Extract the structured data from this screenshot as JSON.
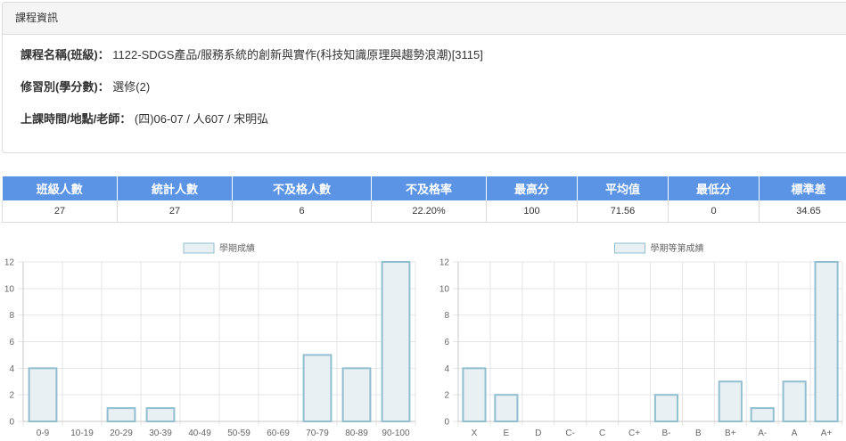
{
  "panel": {
    "title": "課程資訊",
    "course_name_label": "課程名稱(班級)：",
    "course_name_value": "1122-SDGS產品/服務系統的創新與實作(科技知識原理與趨勢浪潮)[3115]",
    "type_label": "修習別(學分數)：",
    "type_value": "選修(2)",
    "time_label": "上課時間/地點/老師：",
    "time_value": "(四)06-07 / 人607 / 宋明弘"
  },
  "stats": {
    "headers": [
      "班級人數",
      "統計人數",
      "不及格人數",
      "不及格率",
      "最高分",
      "平均值",
      "最低分",
      "標準差"
    ],
    "values": [
      "27",
      "27",
      "6",
      "22.20%",
      "100",
      "71.56",
      "0",
      "34.65"
    ]
  },
  "colors": {
    "header_bg": "#5b93e5",
    "bar_fill": "#e8f0f4",
    "bar_stroke": "#92bfcf",
    "grid": "#e5e5e5"
  },
  "chart_data": [
    {
      "type": "bar",
      "legend": "學期成績",
      "categories": [
        "0-9",
        "10-19",
        "20-29",
        "30-39",
        "40-49",
        "50-59",
        "60-69",
        "70-79",
        "80-89",
        "90-100"
      ],
      "values": [
        4,
        0,
        1,
        1,
        0,
        0,
        0,
        5,
        4,
        12
      ],
      "ylim": [
        0,
        12
      ],
      "yticks": [
        0,
        2,
        4,
        6,
        8,
        10,
        12
      ],
      "grid": true,
      "legend_position": "top"
    },
    {
      "type": "bar",
      "legend": "學期等第成績",
      "categories": [
        "X",
        "E",
        "D",
        "C-",
        "C",
        "C+",
        "B-",
        "B",
        "B+",
        "A-",
        "A",
        "A+"
      ],
      "values": [
        4,
        2,
        0,
        0,
        0,
        0,
        2,
        0,
        3,
        1,
        3,
        12
      ],
      "ylim": [
        0,
        12
      ],
      "yticks": [
        0,
        2,
        4,
        6,
        8,
        10,
        12
      ],
      "grid": true,
      "legend_position": "top"
    }
  ]
}
